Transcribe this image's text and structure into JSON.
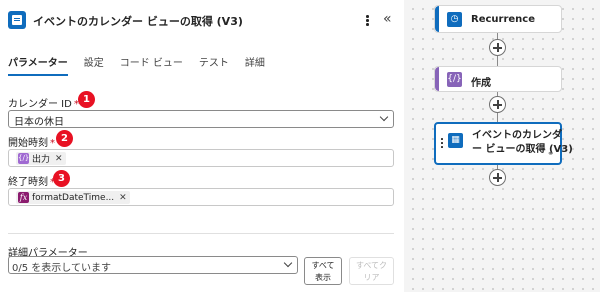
{
  "panel": {
    "title": "イベントのカレンダー ビューの取得 (V3)",
    "more_icon": "more-vertical-icon",
    "collapse_glyph": "«"
  },
  "tabs": [
    {
      "label": "パラメーター",
      "active": true
    },
    {
      "label": "設定"
    },
    {
      "label": "コード ビュー"
    },
    {
      "label": "テスト"
    },
    {
      "label": "詳細"
    }
  ],
  "fields": {
    "calendar_id": {
      "label": "カレンダー ID",
      "required": "*",
      "value": "日本の休日",
      "badge": "1"
    },
    "start_time": {
      "label": "開始時刻",
      "required": "*",
      "token_label": "出力",
      "token_icon": "compose-icon",
      "badge": "2"
    },
    "end_time": {
      "label": "終了時刻",
      "required": "*",
      "token_label": "formatDateTime...",
      "token_icon": "fx-icon",
      "badge": "3"
    }
  },
  "advanced": {
    "label": "詳細パラメーター",
    "select_value": "0/5 を表示しています",
    "show_all_line1": "すべて",
    "show_all_line2": "表示",
    "clear_all_line1": "すべてク",
    "clear_all_line2": "リア"
  },
  "flow": {
    "nodes": [
      {
        "label": "Recurrence",
        "icon": "clock-icon",
        "color": "#0f6cbd"
      },
      {
        "label": "作成",
        "icon": "compose-icon",
        "color": "#8764b8"
      },
      {
        "label_line1": "イベントのカレンダ",
        "label_line2": "ー ビューの取得 (V3)",
        "icon": "outlook-calendar-icon",
        "color": "#0f6cbd",
        "selected": true
      }
    ]
  },
  "colors": {
    "accent": "#0f6cbd",
    "badge": "#e81123",
    "required": "#c50f1f",
    "compose": "#a06ad2",
    "expression": "#8b1b6e"
  }
}
